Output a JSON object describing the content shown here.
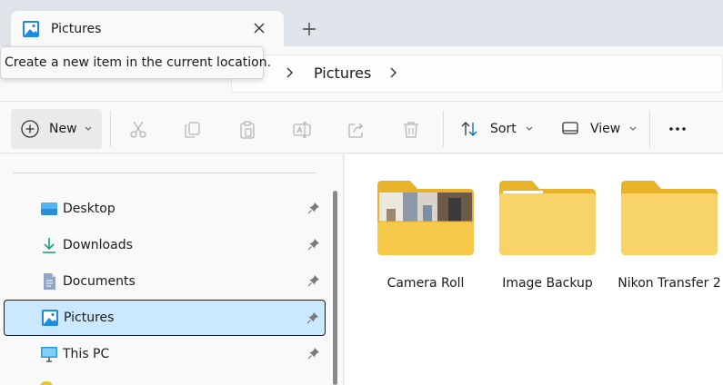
{
  "tab": {
    "title": "Pictures"
  },
  "tooltip": {
    "text": "Create a new item in the current location."
  },
  "address": {
    "crumb": "Pictures"
  },
  "toolbar": {
    "new_label": "New",
    "sort_label": "Sort",
    "view_label": "View"
  },
  "sidebar": {
    "items": [
      {
        "label": "Desktop",
        "icon": "desktop-icon",
        "pinned": true
      },
      {
        "label": "Downloads",
        "icon": "download-icon",
        "pinned": true
      },
      {
        "label": "Documents",
        "icon": "documents-icon",
        "pinned": true
      },
      {
        "label": "Pictures",
        "icon": "pictures-icon",
        "pinned": true,
        "selected": true
      },
      {
        "label": "This PC",
        "icon": "monitor-icon",
        "pinned": true
      }
    ]
  },
  "content": {
    "folders": [
      {
        "label": "Camera Roll",
        "has_thumbnail": true
      },
      {
        "label": "Image Backup",
        "has_thumbnail": false
      },
      {
        "label": "Nikon Transfer 2",
        "has_thumbnail": false
      }
    ]
  },
  "colors": {
    "accent": "#0067c0",
    "selection": "#cce8ff",
    "folder": "#f6c94a",
    "tabstrip": "#dfe3ea"
  }
}
